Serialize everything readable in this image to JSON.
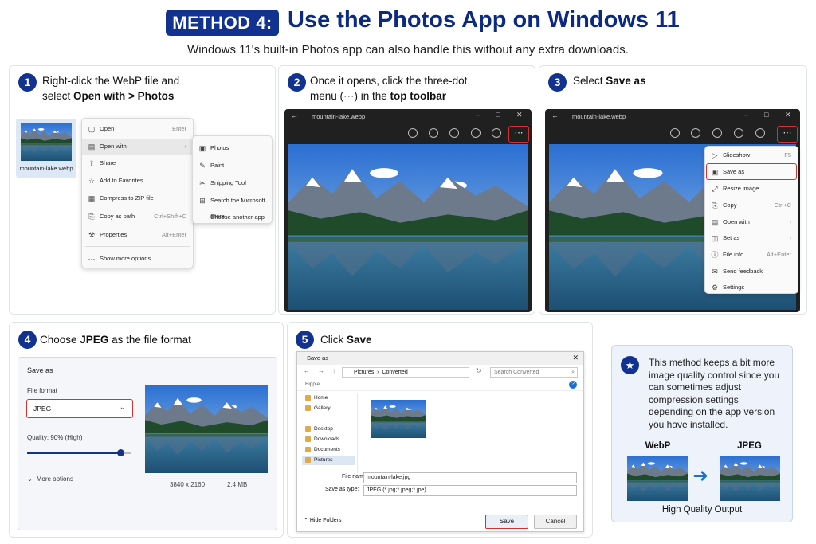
{
  "header": {
    "badge": "METHOD 4:",
    "title": "Use the Photos App on Windows 11",
    "subtitle": "Windows 11's built-in Photos app can also handle this without any extra downloads."
  },
  "step1": {
    "num": "1",
    "line1": "Right-click the WebP file and",
    "line2_pre": "select ",
    "line2_bold": "Open with > Photos",
    "file_label": "mountain-lake.webp",
    "menu": [
      {
        "icon": "open-icon",
        "label": "Open",
        "shortcut": "Enter"
      },
      {
        "icon": "open-with-icon",
        "label": "Open with",
        "shortcut": "›"
      },
      {
        "icon": "share-icon",
        "label": "Share",
        "shortcut": ""
      },
      {
        "icon": "star-icon",
        "label": "Add to Favorites",
        "shortcut": ""
      },
      {
        "icon": "zip-icon",
        "label": "Compress to ZIP file",
        "shortcut": ""
      },
      {
        "icon": "copy-path-icon",
        "label": "Copy as path",
        "shortcut": "Ctrl+Shift+C"
      },
      {
        "icon": "wrench-icon",
        "label": "Properties",
        "shortcut": "Alt+Enter"
      },
      {
        "icon": "more-options-icon",
        "label": "Show more options",
        "shortcut": ""
      }
    ],
    "submenu": [
      {
        "icon": "photos-icon",
        "label": "Photos"
      },
      {
        "icon": "paint-icon",
        "label": "Paint"
      },
      {
        "icon": "snipping-icon",
        "label": "Snipping Tool"
      },
      {
        "icon": "store-icon",
        "label": "Search the Microsoft Store"
      },
      {
        "icon": "",
        "label": "Choose another app"
      }
    ]
  },
  "step2": {
    "num": "2",
    "line1": "Once it opens, click the three-dot",
    "line2_pre": "menu (⋯) in the ",
    "line2_bold": "top toolbar",
    "window_title": "mountain-lake.webp",
    "more_glyph": "⋯"
  },
  "step3": {
    "num": "3",
    "line1_pre": "Select ",
    "line1_bold": "Save as",
    "window_title": "mountain-lake.webp",
    "more_glyph": "⋯",
    "menu": [
      {
        "icon": "slideshow-icon",
        "label": "Slideshow",
        "shortcut": "F5"
      },
      {
        "icon": "save-as-icon",
        "label": "Save as",
        "shortcut": ""
      },
      {
        "icon": "resize-icon",
        "label": "Resize image",
        "shortcut": ""
      },
      {
        "icon": "copy-icon",
        "label": "Copy",
        "shortcut": "Ctrl+C"
      },
      {
        "icon": "open-with-icon",
        "label": "Open with",
        "shortcut": "›"
      },
      {
        "icon": "set-as-icon",
        "label": "Set as",
        "shortcut": "›"
      },
      {
        "icon": "info-icon",
        "label": "File info",
        "shortcut": "Alt+Enter"
      },
      {
        "icon": "feedback-icon",
        "label": "Send feedback",
        "shortcut": ""
      },
      {
        "icon": "settings-icon",
        "label": "Settings",
        "shortcut": ""
      }
    ]
  },
  "step4": {
    "num": "4",
    "pre": "Choose ",
    "bold": "JPEG",
    "post": " as the file format",
    "card_title": "Save as",
    "format_label": "File format",
    "format_value": "JPEG",
    "quality_label": "Quality: 90% (High)",
    "quality": 0.9,
    "more_options": "More options",
    "dimensions": "3840 x 2160",
    "size": "2.4 MB"
  },
  "step5": {
    "num": "5",
    "pre": "Click ",
    "bold": "Save",
    "dialog_title": "Save as",
    "path1": "Pictures",
    "path2": "Converted",
    "search_placeholder": "Search Converted",
    "organize": "Bippie",
    "nav": [
      "Home",
      "Gallery",
      "Desktop",
      "Downloads",
      "Documents",
      "Pictures"
    ],
    "file_name_label": "File name:",
    "file_name": "mountain-lake.jpg",
    "type_label": "Save as type:",
    "type_value": "JPEG (*.jpg;*.jpeg;*.jpe)",
    "hide_folders": "Hide Folders",
    "save": "Save",
    "cancel": "Cancel"
  },
  "info": {
    "text": "This method keeps a bit more image quality control since you can sometimes adjust compression settings depending on the app version you have installed.",
    "webp": "WebP",
    "jpeg": "JPEG",
    "caption": "High Quality Output"
  },
  "colors": {
    "accent": "#12328f",
    "red": "#d8312d"
  }
}
